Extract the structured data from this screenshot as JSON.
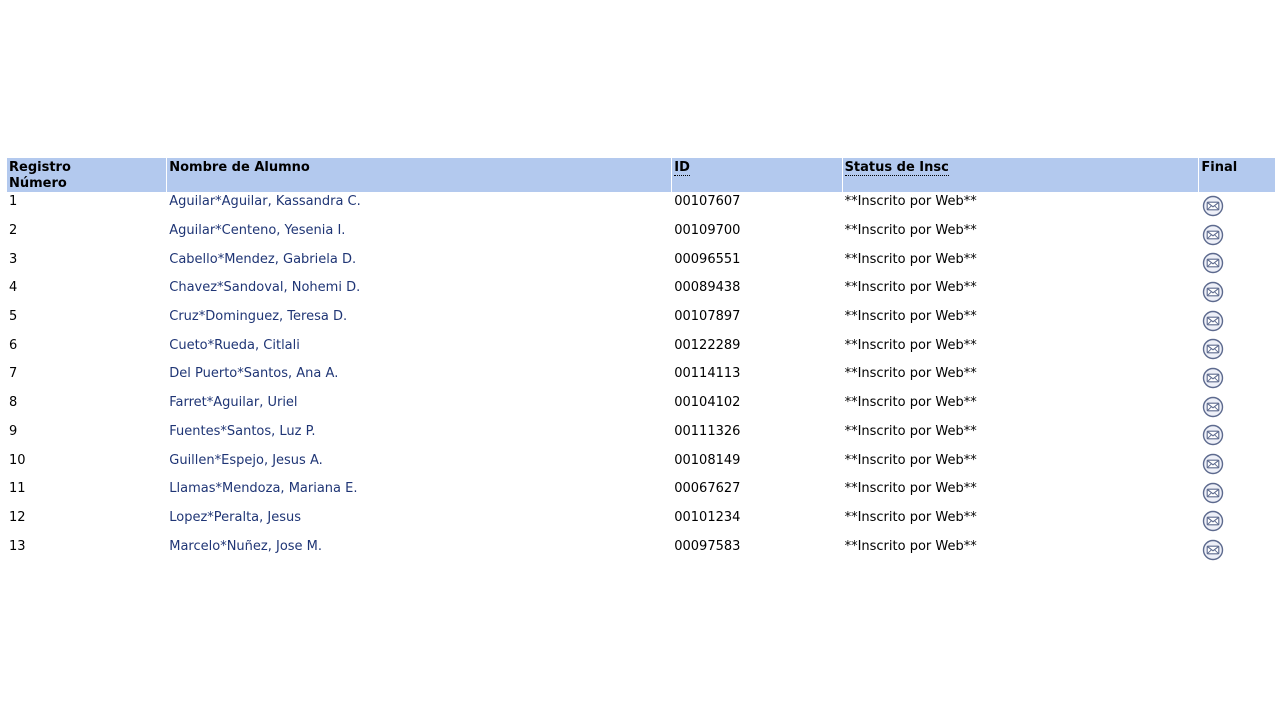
{
  "table": {
    "headers": {
      "registro_line1": "Registro",
      "registro_line2": "Número",
      "nombre": "Nombre de Alumno",
      "id": "ID",
      "status": "Status de Insc",
      "final": "Final"
    },
    "rows": [
      {
        "num": "1",
        "name": "Aguilar*Aguilar, Kassandra C.",
        "id": "00107607",
        "status": "**Inscrito por Web**",
        "icon": "email-icon"
      },
      {
        "num": "2",
        "name": "Aguilar*Centeno, Yesenia I.",
        "id": "00109700",
        "status": "**Inscrito por Web**",
        "icon": "email-icon"
      },
      {
        "num": "3",
        "name": "Cabello*Mendez, Gabriela D.",
        "id": "00096551",
        "status": "**Inscrito por Web**",
        "icon": "email-icon"
      },
      {
        "num": "4",
        "name": "Chavez*Sandoval, Nohemi D.",
        "id": "00089438",
        "status": "**Inscrito por Web**",
        "icon": "email-icon"
      },
      {
        "num": "5",
        "name": "Cruz*Dominguez, Teresa D.",
        "id": "00107897",
        "status": "**Inscrito por Web**",
        "icon": "email-icon"
      },
      {
        "num": "6",
        "name": "Cueto*Rueda, Citlali",
        "id": "00122289",
        "status": "**Inscrito por Web**",
        "icon": "email-icon"
      },
      {
        "num": "7",
        "name": "Del Puerto*Santos, Ana A.",
        "id": "00114113",
        "status": "**Inscrito por Web**",
        "icon": "email-icon"
      },
      {
        "num": "8",
        "name": "Farret*Aguilar, Uriel",
        "id": "00104102",
        "status": "**Inscrito por Web**",
        "icon": "email-icon"
      },
      {
        "num": "9",
        "name": "Fuentes*Santos, Luz P.",
        "id": "00111326",
        "status": "**Inscrito por Web**",
        "icon": "email-icon"
      },
      {
        "num": "10",
        "name": "Guillen*Espejo, Jesus A.",
        "id": "00108149",
        "status": "**Inscrito por Web**",
        "icon": "email-icon"
      },
      {
        "num": "11",
        "name": "Llamas*Mendoza, Mariana E.",
        "id": "00067627",
        "status": "**Inscrito por Web**",
        "icon": "email-icon"
      },
      {
        "num": "12",
        "name": "Lopez*Peralta, Jesus",
        "id": "00101234",
        "status": "**Inscrito por Web**",
        "icon": "email-icon"
      },
      {
        "num": "13",
        "name": "Marcelo*Nuñez, Jose M.",
        "id": "00097583",
        "status": "**Inscrito por Web**",
        "icon": "email-icon"
      }
    ]
  },
  "colors": {
    "header_bg": "#b3c9ee",
    "link": "#1f3575"
  }
}
